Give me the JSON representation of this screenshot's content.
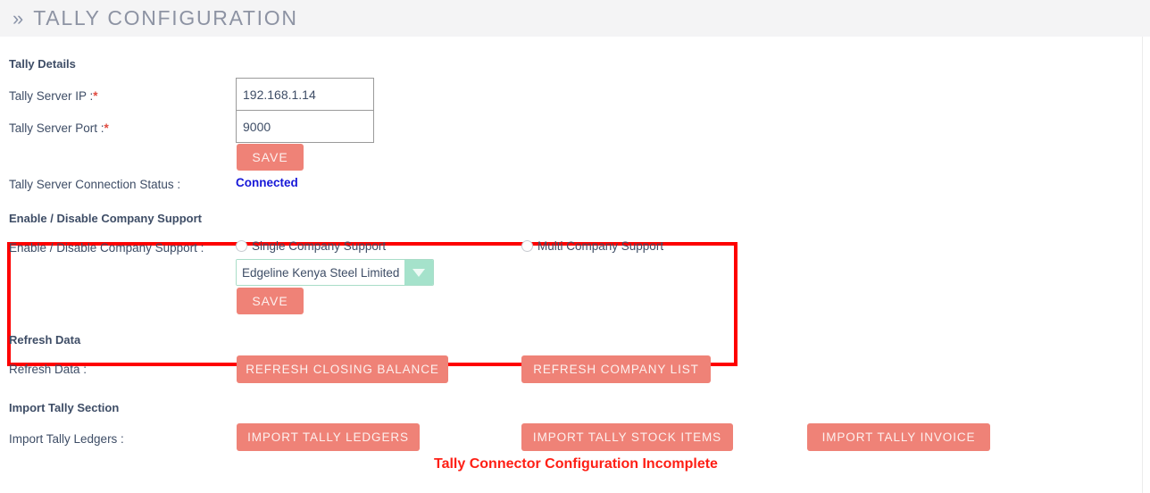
{
  "header": {
    "chevron_icon": "double-chevron-right",
    "title": "TALLY CONFIGURATION"
  },
  "tally_details": {
    "section_title": "Tally Details",
    "server_ip_label": "Tally Server IP :",
    "server_ip_required": "*",
    "server_ip_value": "192.168.1.14",
    "server_ip_placeholder": "",
    "server_port_label": "Tally Server Port :",
    "server_port_required": "*",
    "server_port_value": "9000",
    "server_port_placeholder": "",
    "save_label": "SAVE",
    "connection_status_label": "Tally Server Connection Status :",
    "connection_status_value": "Connected",
    "connection_status_color": "#1718d8"
  },
  "company_support": {
    "section_title": "Enable / Disable Company Support",
    "field_label": "Enable / Disable Company Support :",
    "radios": [
      {
        "label": "Single Company Support",
        "checked": false
      },
      {
        "label": "Multi Company Support",
        "checked": false
      }
    ],
    "company_select": {
      "selected": "Edgeline Kenya Steel Limited",
      "arrow_icon": "chevron-down-icon"
    },
    "save_label": "SAVE",
    "highlight_color": "#fe0000"
  },
  "refresh_data": {
    "section_title": "Refresh Data",
    "field_label": "Refresh Data :",
    "buttons": [
      "REFRESH CLOSING BALANCE",
      "REFRESH COMPANY LIST"
    ]
  },
  "import_tally": {
    "section_title": "Import Tally Section",
    "field_label": "Import Tally Ledgers :",
    "buttons": [
      "IMPORT TALLY LEDGERS",
      "IMPORT TALLY STOCK ITEMS",
      "IMPORT TALLY INVOICE"
    ],
    "error_message": "Tally Connector Configuration Incomplete",
    "error_color": "#fe1f15"
  },
  "theme": {
    "button_color": "#ef8277",
    "header_bg": "#f4f4f5",
    "text_color": "#3e4d66",
    "select_accent": "#a5e2cb"
  }
}
